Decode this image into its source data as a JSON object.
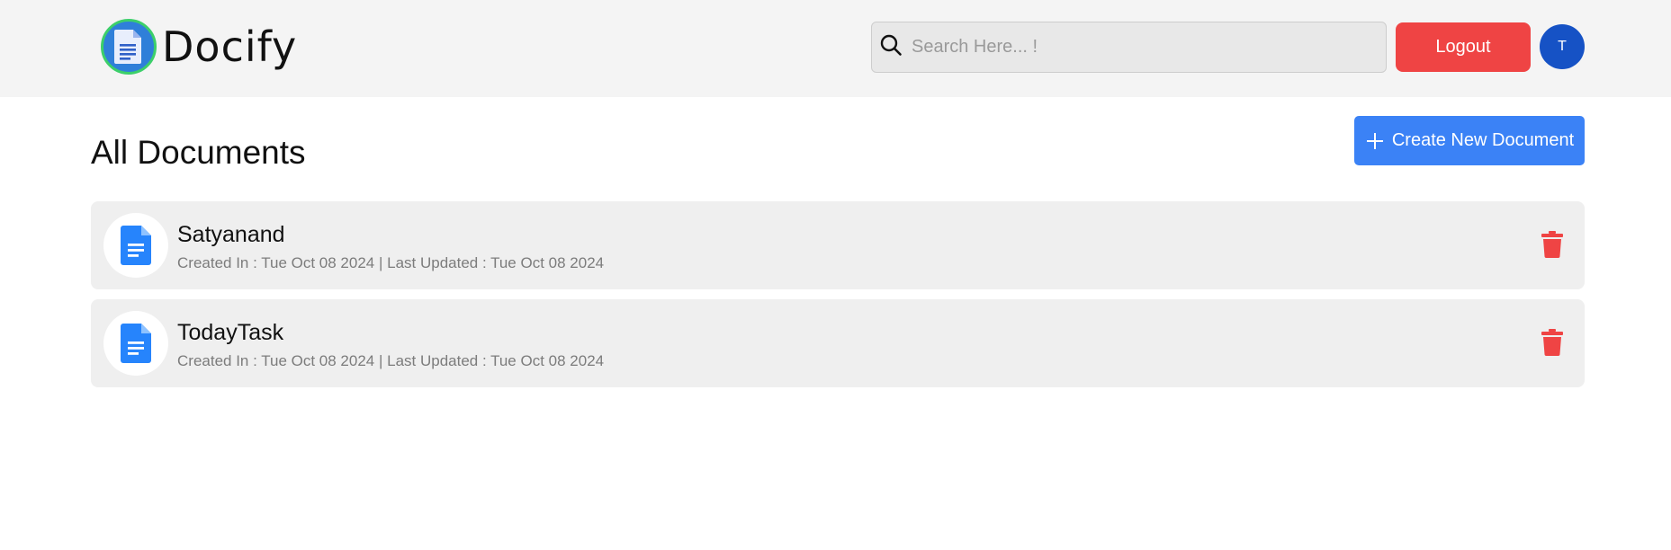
{
  "brand": {
    "name": "Docify",
    "icon": "docs-logo-icon",
    "colors": {
      "ring": "#3ccf6a",
      "badge": "#2f7fd9"
    }
  },
  "header": {
    "search": {
      "placeholder": "Search Here... !",
      "value": "",
      "icon": "search-icon"
    },
    "logout_label": "Logout",
    "avatar_initial": "T"
  },
  "main": {
    "title": "All Documents",
    "create_label": "Create New Document",
    "create_icon": "plus-icon",
    "documents": [
      {
        "title": "Satyanand",
        "meta": "Created In : Tue Oct 08 2024 | Last Updated : Tue Oct 08 2024",
        "icon": "document-icon",
        "action_icon": "trash-icon"
      },
      {
        "title": "TodayTask",
        "meta": "Created In : Tue Oct 08 2024 | Last Updated : Tue Oct 08 2024",
        "icon": "document-icon",
        "action_icon": "trash-icon"
      }
    ]
  },
  "colors": {
    "header_bg": "#f4f4f4",
    "logout": "#ef4444",
    "avatar": "#1652c5",
    "primary": "#3b82f6",
    "danger": "#ef4444",
    "card_bg": "#efefef"
  }
}
